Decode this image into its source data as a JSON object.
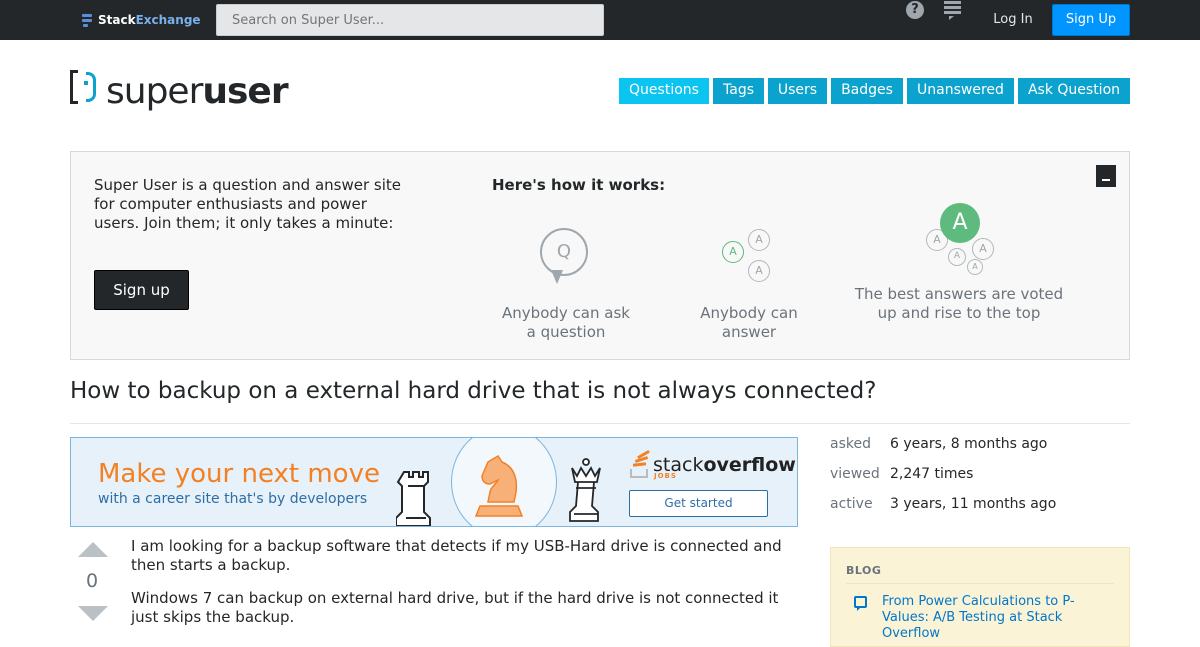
{
  "topbar": {
    "brand_part1": "Stack",
    "brand_part2": "Exchange",
    "search_placeholder": "Search on Super User...",
    "help_glyph": "?",
    "login_label": "Log In",
    "signup_label": "Sign Up"
  },
  "site": {
    "name_part1": "super",
    "name_part2": "user"
  },
  "nav": {
    "items": [
      "Questions",
      "Tags",
      "Users",
      "Badges",
      "Unanswered",
      "Ask Question"
    ],
    "active": "Questions"
  },
  "hero": {
    "intro": "Super User is a question and answer site for computer enthusiasts and power users. Join them; it only takes a minute:",
    "signup_label": "Sign up",
    "how_title": "Here's how it works:",
    "steps": [
      {
        "caption": "Anybody can ask a question",
        "glyph": "Q"
      },
      {
        "caption": "Anybody can answer",
        "glyph": "A"
      },
      {
        "caption": "The best answers are voted up and rise to the top",
        "glyph": "A"
      }
    ]
  },
  "question": {
    "title": "How to backup on a external hard drive that is not always connected?",
    "votes": "0",
    "paragraphs": [
      "I am looking for a backup software that detects if my USB-Hard drive is connected and then starts a backup.",
      "Windows 7 can backup on external hard drive, but if the hard drive is not connected it just skips the backup."
    ]
  },
  "ad": {
    "headline": "Make your next move",
    "subline": "with a career site that's by developers",
    "brand_part1": "stack",
    "brand_part2": "overflow",
    "brand_sub": "JOBS",
    "cta": "Get started"
  },
  "stats": [
    {
      "label": "asked",
      "value": "6 years, 8 months ago"
    },
    {
      "label": "viewed",
      "value": "2,247 times"
    },
    {
      "label": "active",
      "value": "3 years, 11 months ago"
    }
  ],
  "blog": {
    "heading": "BLOG",
    "link": "From Power Calculations to P-Values: A/B Testing at Stack Overflow"
  },
  "colors": {
    "topbar": "#242729",
    "accent": "#0ba3ce",
    "link": "#0077cc",
    "answer_green": "#5eba7d",
    "ad_orange": "#f48024"
  }
}
